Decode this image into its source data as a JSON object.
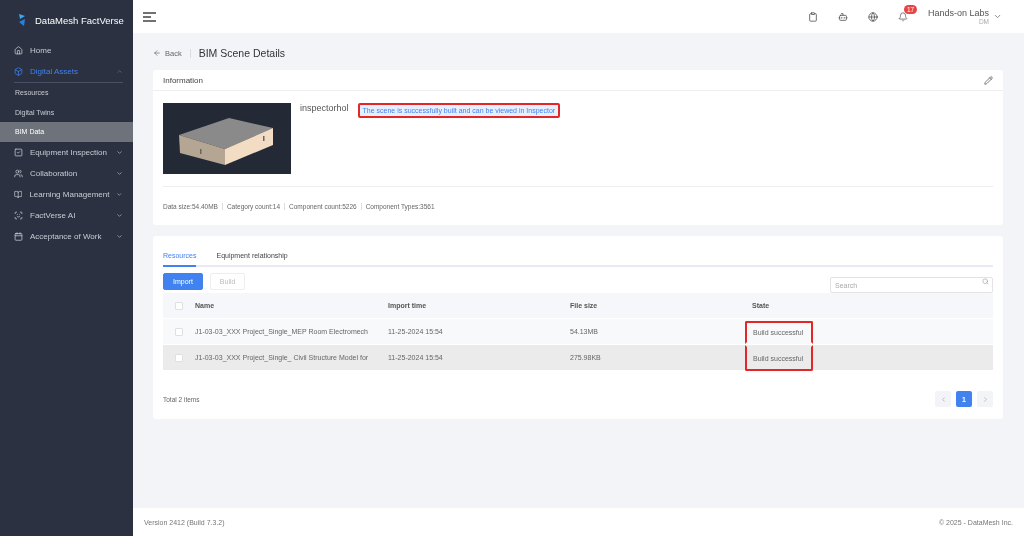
{
  "app": {
    "name": "DataMesh FactVerse"
  },
  "sidebar": {
    "items": [
      {
        "label": "Home",
        "selected": false
      },
      {
        "label": "Digital Assets",
        "selected": true,
        "expanded": true,
        "children": [
          {
            "label": "Resources",
            "selected": false
          },
          {
            "label": "Digital Twins",
            "selected": false
          },
          {
            "label": "BIM Data",
            "selected": true
          }
        ]
      },
      {
        "label": "Equipment Inspection",
        "selected": false,
        "expanded": false
      },
      {
        "label": "Collaboration",
        "selected": false,
        "expanded": false
      },
      {
        "label": "Learning Management",
        "selected": false,
        "expanded": false
      },
      {
        "label": "FactVerse AI",
        "selected": false,
        "expanded": false
      },
      {
        "label": "Acceptance of Work",
        "selected": false,
        "expanded": false
      }
    ]
  },
  "header": {
    "notifications": "17",
    "user": {
      "name": "Hands-on Labs",
      "initials": "DM"
    }
  },
  "page": {
    "back": "Back",
    "title": "BIM Scene Details"
  },
  "information": {
    "title": "Information",
    "scene_name": "inspectorhol",
    "notice": {
      "text": "The scene is successfully built and can be viewed in Inspector",
      "highlighted": true
    },
    "stats": [
      "Data size:54.40MB",
      "Category count:14",
      "Component count:5226",
      "Component Types:3561"
    ]
  },
  "tabs": [
    {
      "label": "Resources",
      "selected": true
    },
    {
      "label": "Equipment relationship",
      "selected": false
    }
  ],
  "toolbar": {
    "buttons": [
      {
        "label": "Import",
        "disabled": false
      },
      {
        "label": "Build",
        "disabled": true
      }
    ],
    "search": {
      "placeholder": "Search"
    }
  },
  "table": {
    "columns": [
      "Name",
      "Import time",
      "File size",
      "State"
    ],
    "select_all": {
      "checked": false
    },
    "rows": [
      {
        "checked": false,
        "name": "J1-03-03_XXX Project_Single_MEP Room Electromech",
        "import_time": "11-25-2024 15:54",
        "file_size": "54.13MB",
        "state": "Build successful",
        "highlighted": true,
        "selected": false
      },
      {
        "checked": false,
        "name": "J1-03-03_XXX Project_Single_ Civil Structure Model for",
        "import_time": "11-25-2024 15:54",
        "file_size": "275.98KB",
        "state": "Build successful",
        "highlighted": true,
        "selected": true
      }
    ]
  },
  "pagination": {
    "total": "Total 2 items",
    "pages": [
      {
        "label": "1",
        "selected": true
      }
    ]
  },
  "footer": {
    "version": "Version 2412 (Build 7.3.2)",
    "copyright": "© 2025 - DataMesh Inc."
  }
}
